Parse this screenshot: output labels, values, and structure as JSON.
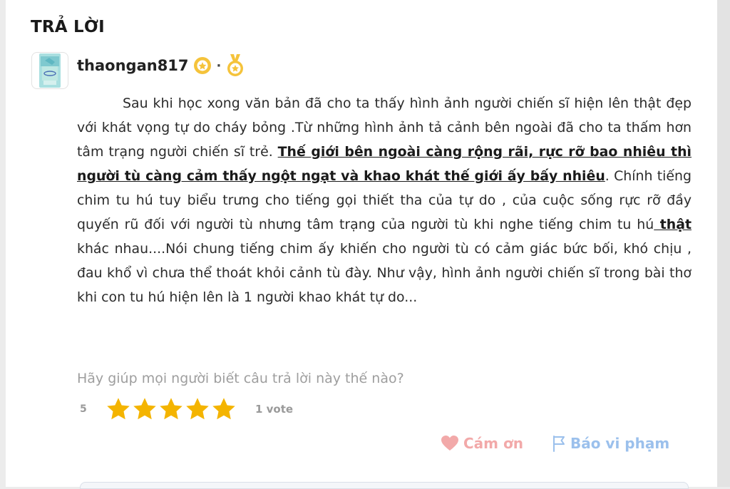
{
  "section": {
    "heading": "TRẢ LỜI"
  },
  "user": {
    "name": "thaongan817",
    "separator": "·",
    "badges": [
      "gold-badge-icon",
      "medal-icon"
    ]
  },
  "answer": {
    "part1": "Sau khi học xong văn bản đã cho ta thấy hình ảnh người chiến sĩ hiện lên thật đẹp với khát vọng tự do cháy bỏng .Từ những hình ảnh tả cảnh bên ngoài đã cho ta thấm hơn tâm trạng người chiến sĩ trẻ. ",
    "highlight1": "Thế giới bên ngoài càng rộng rãi, rực rỡ bao nhiêu thì người tù càng cảm thấy ngột ngạt và khao khát thế giới ấy bấy nhiêu",
    "part2": ". Chính tiếng chim tu hú tuy biểu trưng cho tiếng gọi thiết tha của tự do , của cuộc sống rực rỡ đầy quyến rũ đối với người tù nhưng tâm trạng của người tù khi nghe tiếng chim tu hú",
    "highlight2": " thật ",
    "part3": "khác nhau....Nói chung tiếng chim ấy khiến cho người tù có cảm giác bức bối, khó chịu , đau khổ vì chưa thể thoát khỏi cảnh tù đày. Như vậy, hình ảnh người chiến sĩ trong bài thơ khi con tu hú hiện lên là 1 người khao khát tự do..."
  },
  "rating": {
    "prompt": "Hãy giúp mọi người biết câu trả lời này thế nào?",
    "value": "5",
    "stars": 5,
    "max_stars": 5,
    "votes": "1 vote"
  },
  "actions": {
    "thanks_label": "Cám ơn",
    "report_label": "Báo vi phạm"
  },
  "colors": {
    "star": "#f4b400",
    "thanks": "#f2a9a9",
    "report": "#9bc0ec",
    "badge": "#f5c33b"
  }
}
